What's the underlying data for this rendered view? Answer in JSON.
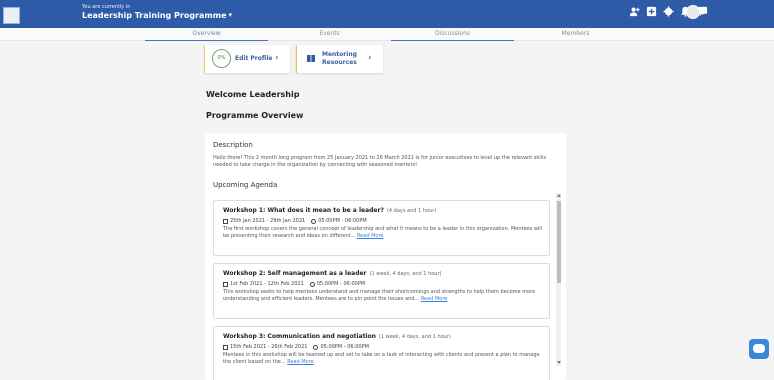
{
  "header": {
    "context_label": "You are currently in",
    "programme_name": "Leadership Training Programme",
    "icons": [
      "add-user-icon",
      "add-icon",
      "gear-icon",
      "bell-icon",
      "chat-icon"
    ]
  },
  "tabs": [
    {
      "label": "Overview",
      "active": true
    },
    {
      "label": "Events",
      "active": false
    },
    {
      "label": "Discussions",
      "active": false
    },
    {
      "label": "Members",
      "active": false
    }
  ],
  "actions": {
    "edit_profile": {
      "progress": "0%",
      "label": "Edit Profile"
    },
    "mentoring": {
      "label": "Mentoring Resources"
    }
  },
  "welcome": "Welcome Leadership",
  "overview_title": "Programme Overview",
  "description": {
    "title": "Description",
    "text": "Hello there! This 2 month long program from 25 January 2021 to 26 March 2021 is for junior executives to level up the relevant skills needed to take charge in the organization by connecting with seasoned mentors!"
  },
  "agenda": {
    "title": "Upcoming Agenda",
    "items": [
      {
        "title": "Workshop 1: What does it mean to be a leader?",
        "duration": "(4 days and 1 hour)",
        "dates": "25th Jan 2021 - 29th Jan 2021",
        "time": "05:00PM - 06:00PM",
        "desc": "The first workshop covers the general concept of leadership and what it means to be a leader in this organization. Mentees will be presenting their research and ideas on different...",
        "more": "Read More"
      },
      {
        "title": "Workshop 2: Self management as a leader",
        "duration": "(1 week, 4 days, and 1 hour)",
        "dates": "1st Feb 2021 - 12th Feb 2021",
        "time": "05:00PM - 06:00PM",
        "desc": "This workshop seeks to help mentees understand and manage their shortcomings and strengths to help them become more understanding and efficient leaders. Mentees are to pin point the issues and...",
        "more": "Read More"
      },
      {
        "title": "Workshop 3: Communication and negotiation",
        "duration": "(1 week, 4 days, and 1 hour)",
        "dates": "15th Feb 2021 - 26th Feb 2021",
        "time": "05:00PM - 06:00PM",
        "desc": "Mentees in this workshop will be teamed up and set to take on a task of interacting with clients and present a plan to manage the client based on the...",
        "more": "Read More"
      }
    ]
  },
  "colors": {
    "header": "#2e5ba8",
    "accent": "#3b86d8",
    "link": "#3b7fd6"
  }
}
